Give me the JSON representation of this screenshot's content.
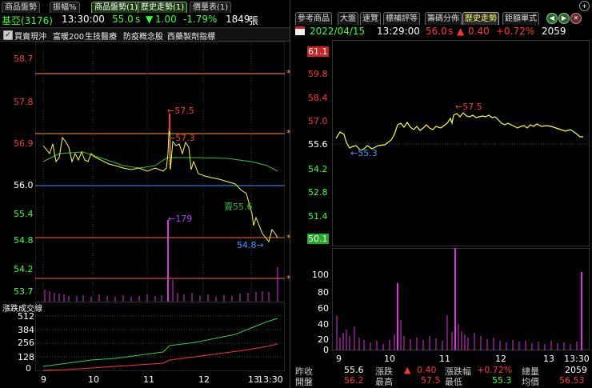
{
  "left_tabs": [
    "商品盤勢",
    "振幅%",
    "商品盤勢(1)",
    "歷史走勢(1)",
    "價量表(1)"
  ],
  "left_header": {
    "symbol": "基亞(3176)",
    "time": "13:30:00",
    "price": "55.0",
    "price_unit": "s",
    "change_arrow": "▼",
    "change": "1.00",
    "change_pct": "-1.79%",
    "volume": "1849",
    "volume_unit": "張"
  },
  "legend_items": [
    "買賣現沖",
    "富暖200",
    "生技醫療",
    "防疫概念股",
    "西藥製劑指標"
  ],
  "left_price_axis": [
    "58.7",
    "57.8",
    "56.9",
    "56.0",
    "55.4",
    "54.8",
    "54.2",
    "53.7"
  ],
  "left_price_annotations": {
    "high": "←57.5",
    "near_high": "←57.3",
    "low": "54.8→",
    "avg": "賣55.6",
    "vol_peak": "←179"
  },
  "left_sub_title": "漲跌成交線",
  "left_sub_axis": [
    "512",
    "384",
    "256",
    "128",
    "0"
  ],
  "left_time_axis": [
    "9",
    "10",
    "11",
    "12",
    "13",
    "13:30"
  ],
  "right_tabs": [
    "參考商品",
    "大盤",
    "速覽",
    "標補評等",
    "籌碼分佈",
    "歷史走勢",
    "鉅額單式"
  ],
  "right_header": {
    "date": "2022/04/15",
    "time": "13:29:00",
    "price": "56.0",
    "price_unit": "s",
    "change": "0.40",
    "change_pct": "+0.72%",
    "volume": "2059"
  },
  "right_price_axis": [
    "61.1",
    "59.8",
    "58.4",
    "57.0",
    "55.6",
    "54.2",
    "52.8",
    "51.4",
    "50.1"
  ],
  "right_price_annotations": {
    "high": "←57.5",
    "low": "←55.3"
  },
  "right_vol_axis": [
    "100",
    "80",
    "60",
    "40",
    "20",
    "0"
  ],
  "right_time_axis": [
    "9",
    "10",
    "11",
    "12",
    "13",
    "13:30"
  ],
  "stats": {
    "prev_close_label": "昨收",
    "prev_close": "55.6",
    "change_label": "漲跌",
    "change_arrow": "▲",
    "change": "0.40",
    "change_pct_label": "漲跌幅",
    "change_pct": "+0.72%",
    "total_vol_label": "總量",
    "total_vol": "2059",
    "open_label": "開盤",
    "open": "56.2",
    "high_label": "最高",
    "high": "57.5",
    "low_label": "最低",
    "low": "55.3",
    "avg_label": "均價",
    "avg": "56.53"
  },
  "colors": {
    "up": "#ff3333",
    "down": "#33cc33",
    "line": "#ffff33",
    "volume": "#dd33dd",
    "avg": "#33bb33",
    "cyan": "#3399ff"
  }
}
